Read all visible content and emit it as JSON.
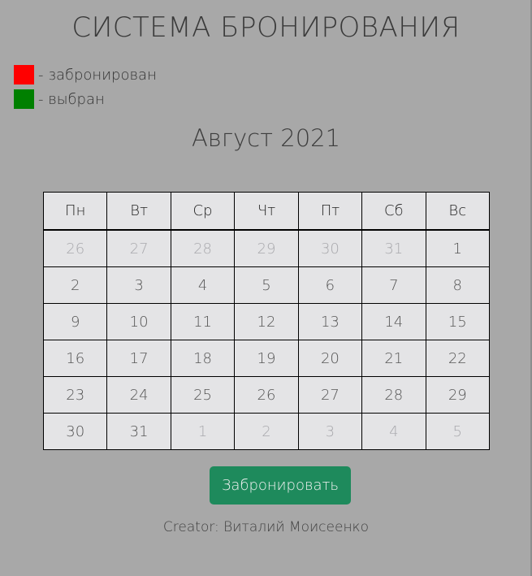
{
  "header": {
    "title": "СИСТЕМА БРОНИРОВАНИЯ"
  },
  "legend": {
    "items": [
      {
        "label": "- забронирован",
        "color": "#ff0000"
      },
      {
        "label": "- выбран",
        "color": "#008000"
      }
    ]
  },
  "calendar": {
    "month_label": "Август 2021",
    "weekdays": [
      "Пн",
      "Вт",
      "Ср",
      "Чт",
      "Пт",
      "Сб",
      "Вс"
    ],
    "weeks": [
      [
        {
          "d": "26",
          "other": true
        },
        {
          "d": "27",
          "other": true
        },
        {
          "d": "28",
          "other": true
        },
        {
          "d": "29",
          "other": true
        },
        {
          "d": "30",
          "other": true
        },
        {
          "d": "31",
          "other": true
        },
        {
          "d": "1",
          "other": false
        }
      ],
      [
        {
          "d": "2",
          "other": false
        },
        {
          "d": "3",
          "other": false
        },
        {
          "d": "4",
          "other": false
        },
        {
          "d": "5",
          "other": false
        },
        {
          "d": "6",
          "other": false
        },
        {
          "d": "7",
          "other": false
        },
        {
          "d": "8",
          "other": false
        }
      ],
      [
        {
          "d": "9",
          "other": false
        },
        {
          "d": "10",
          "other": false
        },
        {
          "d": "11",
          "other": false
        },
        {
          "d": "12",
          "other": false
        },
        {
          "d": "13",
          "other": false
        },
        {
          "d": "14",
          "other": false
        },
        {
          "d": "15",
          "other": false
        }
      ],
      [
        {
          "d": "16",
          "other": false
        },
        {
          "d": "17",
          "other": false
        },
        {
          "d": "18",
          "other": false
        },
        {
          "d": "19",
          "other": false
        },
        {
          "d": "20",
          "other": false
        },
        {
          "d": "21",
          "other": false
        },
        {
          "d": "22",
          "other": false
        }
      ],
      [
        {
          "d": "23",
          "other": false
        },
        {
          "d": "24",
          "other": false
        },
        {
          "d": "25",
          "other": false
        },
        {
          "d": "26",
          "other": false
        },
        {
          "d": "27",
          "other": false
        },
        {
          "d": "28",
          "other": false
        },
        {
          "d": "29",
          "other": false
        }
      ],
      [
        {
          "d": "30",
          "other": false
        },
        {
          "d": "31",
          "other": false
        },
        {
          "d": "1",
          "other": true
        },
        {
          "d": "2",
          "other": true
        },
        {
          "d": "3",
          "other": true
        },
        {
          "d": "4",
          "other": true
        },
        {
          "d": "5",
          "other": true
        }
      ]
    ]
  },
  "actions": {
    "book_label": "Забронировать",
    "button_color": "#1e8a5c"
  },
  "footer": {
    "creator": "Creator: Виталий Моисеенко"
  }
}
